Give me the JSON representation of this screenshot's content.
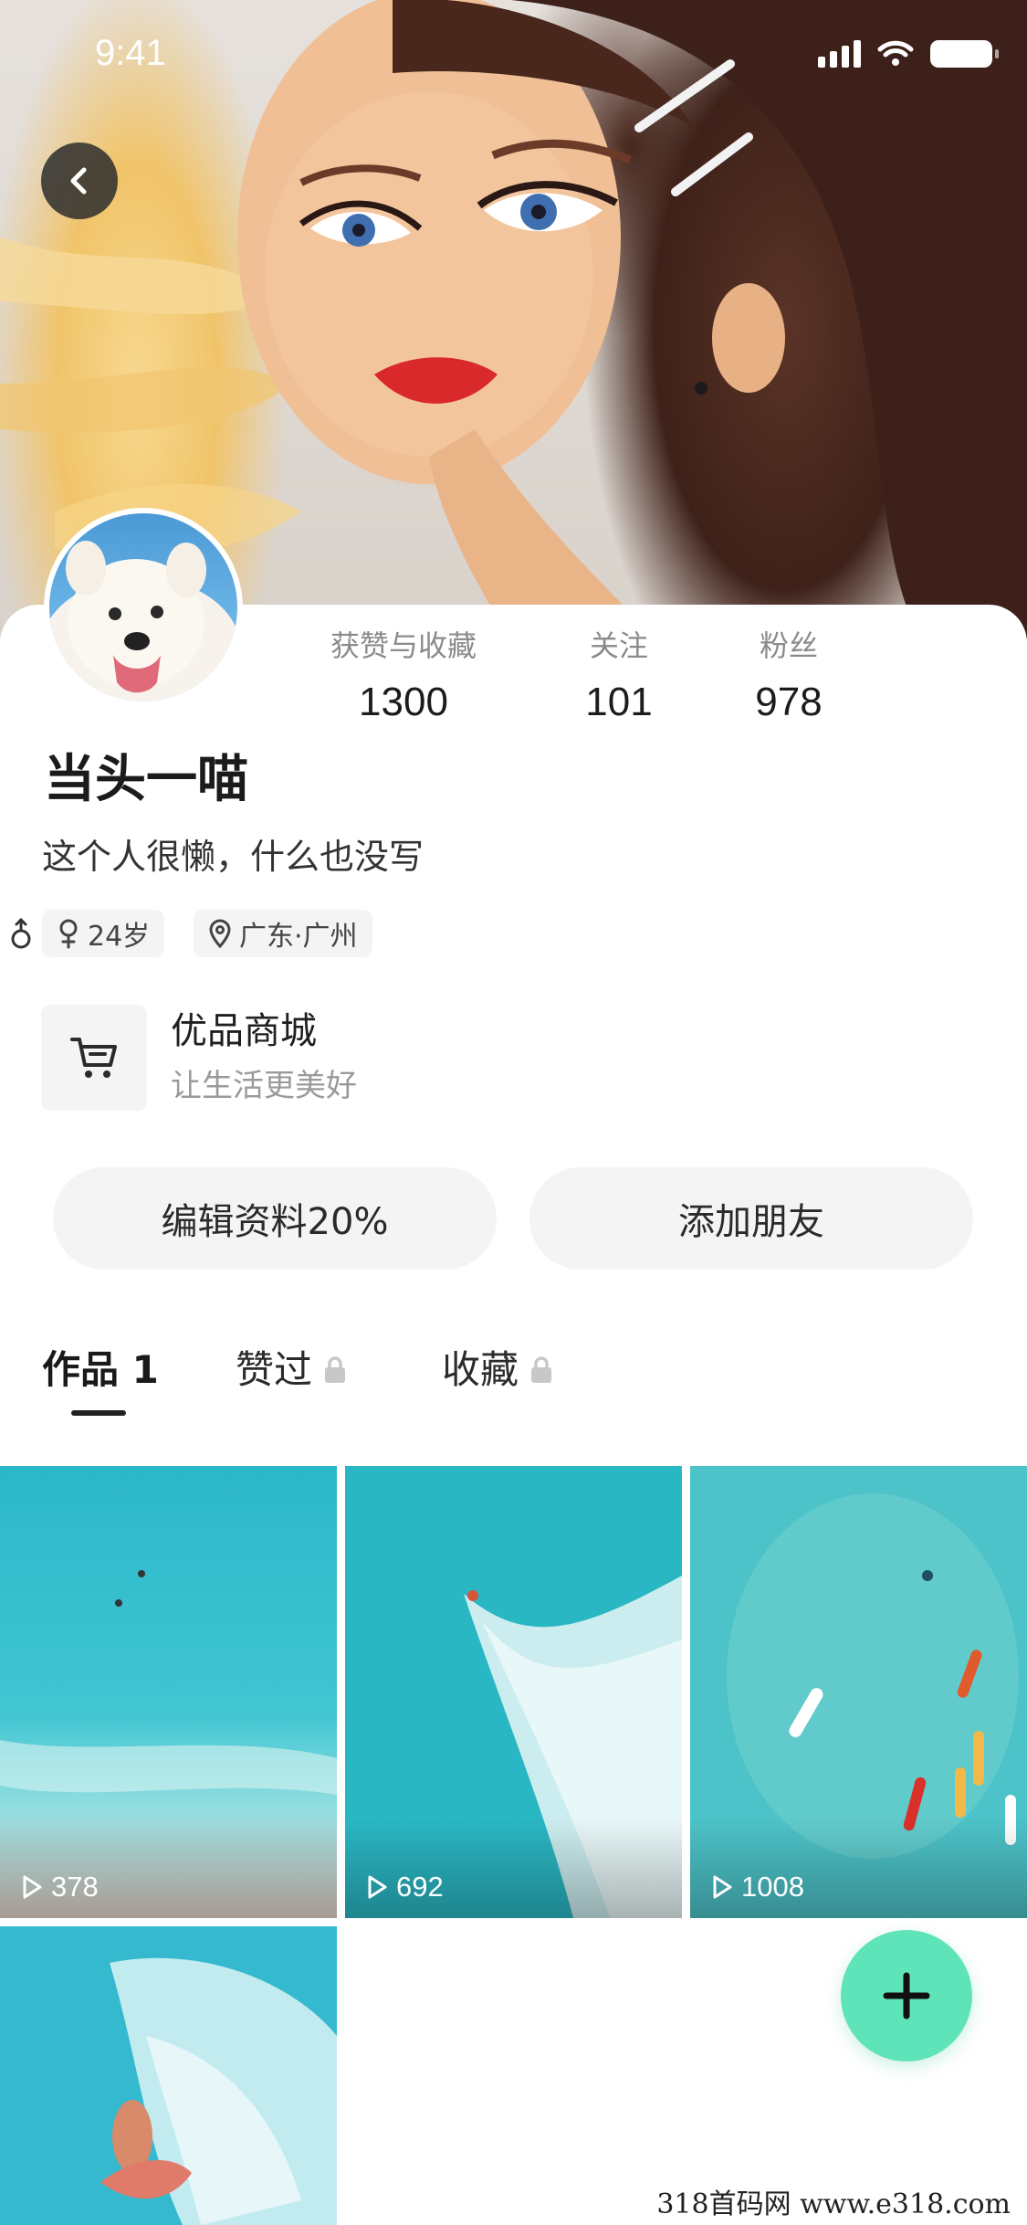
{
  "status_bar": {
    "time": "9:41"
  },
  "profile": {
    "username": "当头一喵",
    "bio": "这个人很懒，什么也没写",
    "age_tag": "24岁",
    "location_tag": "广东·广州"
  },
  "stats": [
    {
      "label": "获赞与收藏",
      "value": "1300"
    },
    {
      "label": "关注",
      "value": "101"
    },
    {
      "label": "粉丝",
      "value": "978"
    }
  ],
  "shop": {
    "title": "优品商城",
    "subtitle": "让生活更美好"
  },
  "actions": {
    "edit_label": "编辑资料20%",
    "add_friend_label": "添加朋友"
  },
  "tabs": [
    {
      "label": "作品 1",
      "locked": false,
      "active": true
    },
    {
      "label": "赞过",
      "locked": true,
      "active": false
    },
    {
      "label": "收藏",
      "locked": true,
      "active": false
    }
  ],
  "posts": [
    {
      "plays": "378"
    },
    {
      "plays": "692"
    },
    {
      "plays": "1008"
    },
    {
      "plays": ""
    }
  ],
  "watermark": "318首码网 www.e318.com",
  "icons": {
    "back": "chevron-left-icon",
    "signal": "signal-icon",
    "wifi": "wifi-icon",
    "battery": "battery-icon",
    "gender": "female-icon",
    "location": "location-pin-icon",
    "shop": "cart-icon",
    "lock": "lock-icon",
    "play": "play-icon",
    "fab": "plus-icon"
  },
  "colors": {
    "accent": "#5fe3b8",
    "button_bg": "#f4f4f4",
    "text_primary": "#1b1b1b",
    "text_secondary": "#8b8b8b"
  }
}
